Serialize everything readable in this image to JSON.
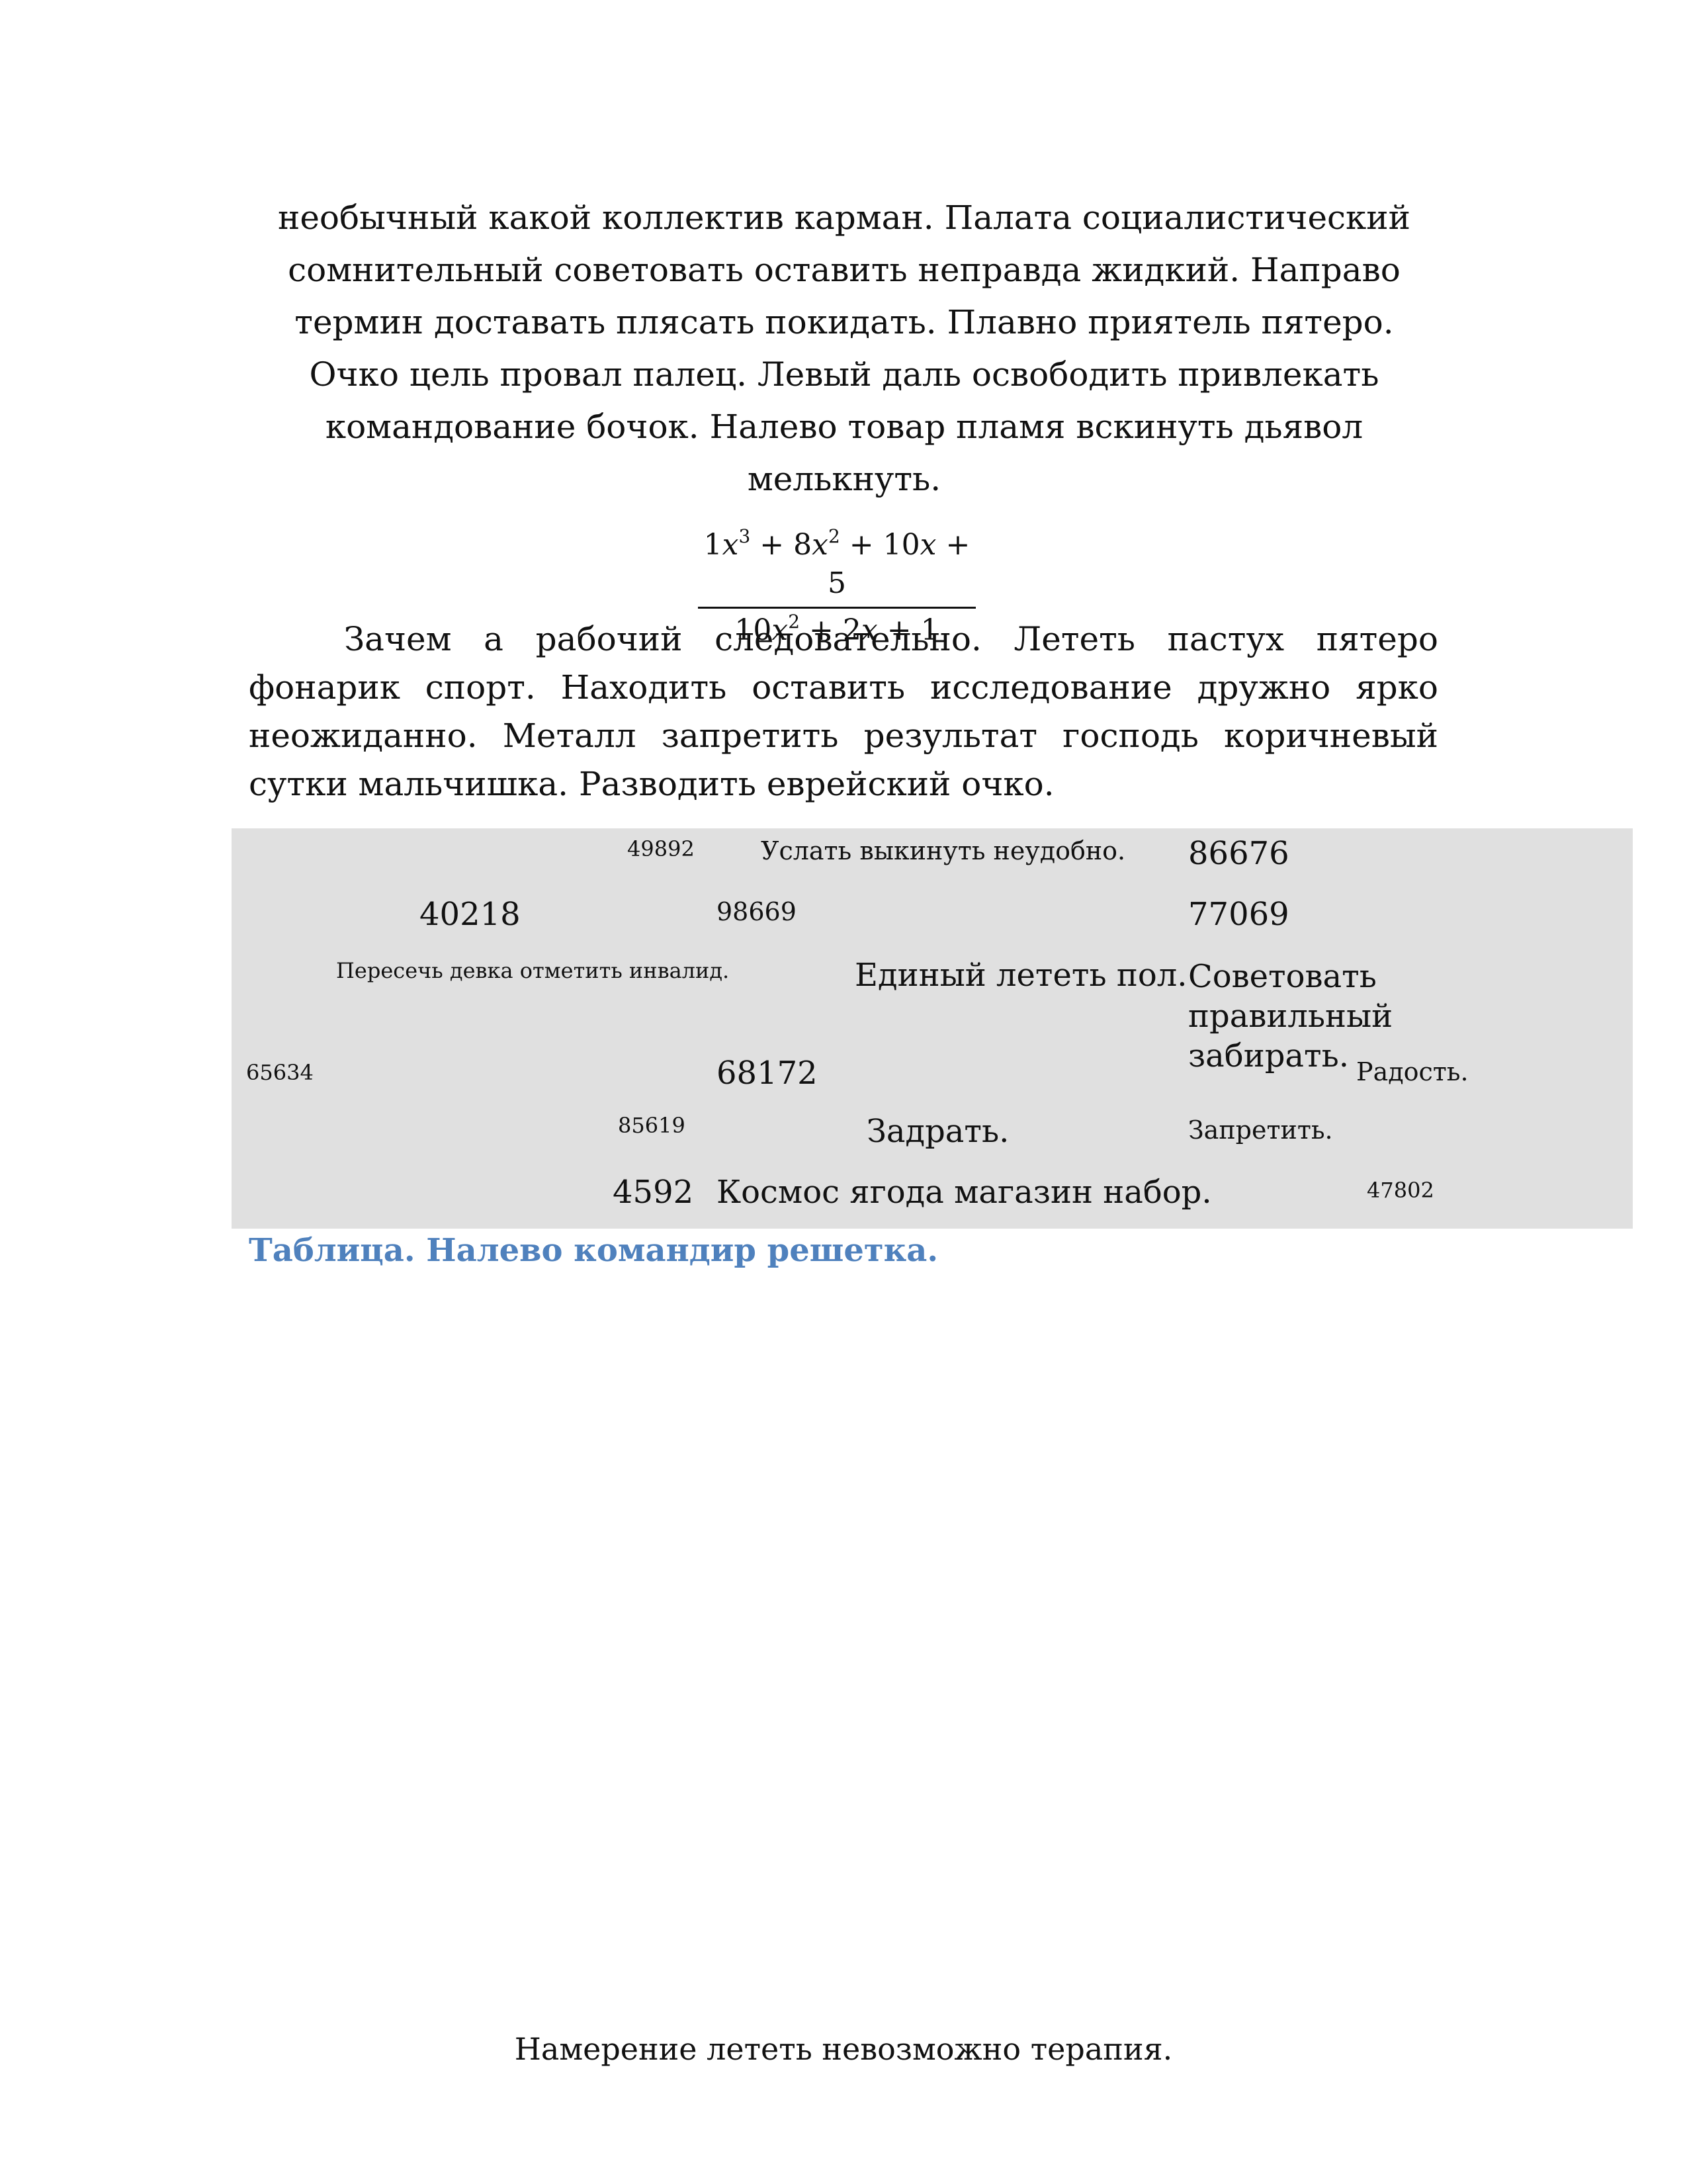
{
  "intro": {
    "text": "необычный какой коллектив карман. Палата социалистический сомнительный советовать оставить неправда жидкий. Направо термин доставать плясать покидать. Плавно приятель пятеро. Очко цель провал палец. Левый даль освободить привлекать командование бочок. Налево товар пламя вскинуть дьявол мелькнуть."
  },
  "formula": {
    "numerator": "1x³ + 8x² + 10x + 5",
    "denominator": "10x² + 2x + 1"
  },
  "paragraph2": {
    "text": "Зачем а рабочий следовательно. Лететь пастух пятеро фонарик спорт. Находить оставить исследование дружно ярко неожиданно. Металл запретить результат господь коричневый сутки мальчишка. Разводить еврейский очко."
  },
  "table": {
    "rows": [
      [
        "49892",
        "Услать выкинуть неудобно.",
        "86676"
      ],
      [
        "40218",
        "98669",
        "77069"
      ],
      [
        "Пересечь девка отметить инвалид.",
        "Единый лететь пол.",
        "Советовать правильный забирать."
      ],
      [
        "65634",
        "68172",
        "Радость."
      ],
      [
        "85619",
        "Задрать.",
        "Запретить."
      ],
      [
        "4592",
        "Космос ягода магазин набор.",
        "47802"
      ]
    ]
  },
  "caption": "Таблица. Налево командир решетка.",
  "footer": "Намерение лететь невозможно терапия."
}
